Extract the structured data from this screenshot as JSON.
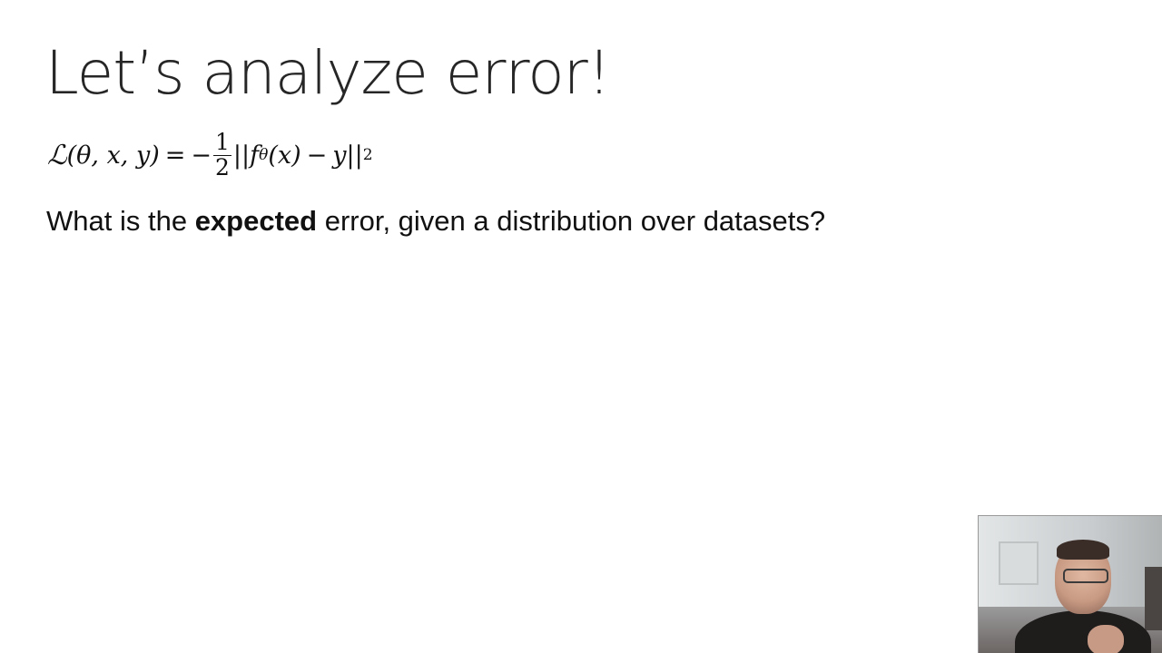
{
  "slide": {
    "title": "Let’s analyze error!",
    "formula": {
      "lhs_symbol": "ℒ",
      "lhs_args": "(θ, x, y)",
      "equals": "=",
      "minus": "−",
      "frac_num": "1",
      "frac_den": "2",
      "norm_open": "||",
      "func": "f",
      "func_sub": "θ",
      "func_arg": "(x)",
      "minus2": "−",
      "y": "y",
      "norm_close": "||",
      "power": "2"
    },
    "body_prefix": "What is the ",
    "body_bold": "expected",
    "body_suffix": " error, given a distribution over datasets?"
  }
}
